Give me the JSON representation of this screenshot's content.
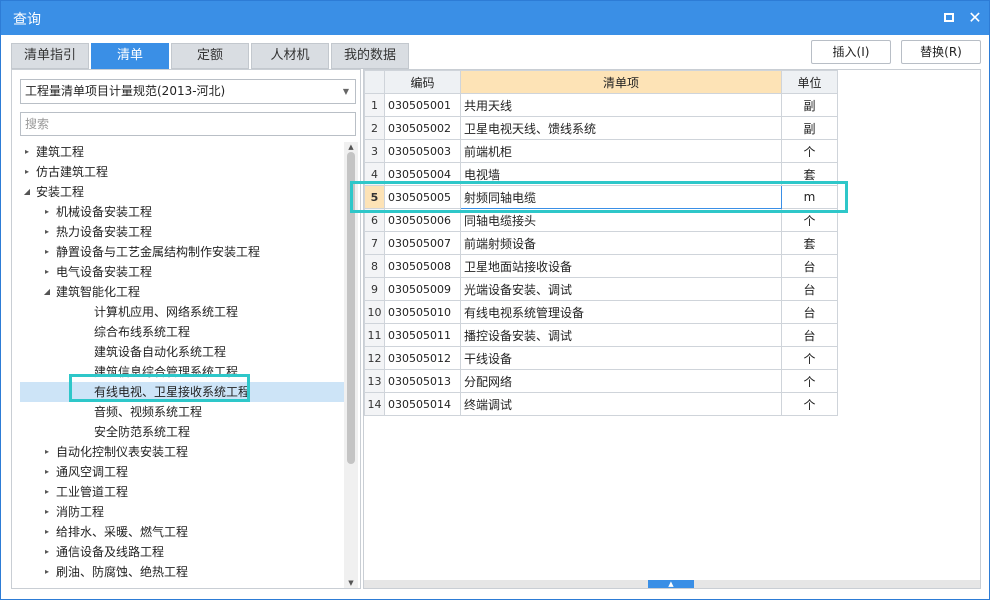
{
  "window": {
    "title": "查询"
  },
  "tabs": [
    {
      "label": "清单指引"
    },
    {
      "label": "清单"
    },
    {
      "label": "定额"
    },
    {
      "label": "人材机"
    },
    {
      "label": "我的数据"
    }
  ],
  "actions": {
    "insert_label": "插入(I)",
    "replace_label": "替换(R)"
  },
  "left": {
    "standard_select": "工程量清单项目计量规范(2013-河北)",
    "search_placeholder": "搜索",
    "tree": [
      {
        "label": "建筑工程",
        "caret": "▸",
        "level": 0
      },
      {
        "label": "仿古建筑工程",
        "caret": "▸",
        "level": 0
      },
      {
        "label": "安装工程",
        "caret": "◢",
        "level": 0
      },
      {
        "label": "机械设备安装工程",
        "caret": "▸",
        "level": 1
      },
      {
        "label": "热力设备安装工程",
        "caret": "▸",
        "level": 1
      },
      {
        "label": "静置设备与工艺金属结构制作安装工程",
        "caret": "▸",
        "level": 1
      },
      {
        "label": "电气设备安装工程",
        "caret": "▸",
        "level": 1
      },
      {
        "label": "建筑智能化工程",
        "caret": "◢",
        "level": 1
      },
      {
        "label": "计算机应用、网络系统工程",
        "caret": "",
        "level": 2
      },
      {
        "label": "综合布线系统工程",
        "caret": "",
        "level": 2
      },
      {
        "label": "建筑设备自动化系统工程",
        "caret": "",
        "level": 2
      },
      {
        "label": "建筑信息综合管理系统工程",
        "caret": "",
        "level": 2
      },
      {
        "label": "有线电视、卫星接收系统工程",
        "caret": "",
        "level": 2
      },
      {
        "label": "音频、视频系统工程",
        "caret": "",
        "level": 2
      },
      {
        "label": "安全防范系统工程",
        "caret": "",
        "level": 2
      },
      {
        "label": "自动化控制仪表安装工程",
        "caret": "▸",
        "level": 1
      },
      {
        "label": "通风空调工程",
        "caret": "▸",
        "level": 1
      },
      {
        "label": "工业管道工程",
        "caret": "▸",
        "level": 1
      },
      {
        "label": "消防工程",
        "caret": "▸",
        "level": 1
      },
      {
        "label": "给排水、采暖、燃气工程",
        "caret": "▸",
        "level": 1
      },
      {
        "label": "通信设备及线路工程",
        "caret": "▸",
        "level": 1
      },
      {
        "label": "刷油、防腐蚀、绝热工程",
        "caret": "▸",
        "level": 1
      }
    ]
  },
  "grid": {
    "headers": {
      "index": "",
      "code": "编码",
      "name": "清单项",
      "unit": "单位"
    },
    "rows": [
      {
        "index": "1",
        "code": "030505001",
        "name": "共用天线",
        "unit": "副"
      },
      {
        "index": "2",
        "code": "030505002",
        "name": "卫星电视天线、馈线系统",
        "unit": "副"
      },
      {
        "index": "3",
        "code": "030505003",
        "name": "前端机柜",
        "unit": "个"
      },
      {
        "index": "4",
        "code": "030505004",
        "name": "电视墙",
        "unit": "套"
      },
      {
        "index": "5",
        "code": "030505005",
        "name": "射频同轴电缆",
        "unit": "m"
      },
      {
        "index": "6",
        "code": "030505006",
        "name": "同轴电缆接头",
        "unit": "个"
      },
      {
        "index": "7",
        "code": "030505007",
        "name": "前端射频设备",
        "unit": "套"
      },
      {
        "index": "8",
        "code": "030505008",
        "name": "卫星地面站接收设备",
        "unit": "台"
      },
      {
        "index": "9",
        "code": "030505009",
        "name": "光端设备安装、调试",
        "unit": "台"
      },
      {
        "index": "10",
        "code": "030505010",
        "name": "有线电视系统管理设备",
        "unit": "台"
      },
      {
        "index": "11",
        "code": "030505011",
        "name": "播控设备安装、调试",
        "unit": "台"
      },
      {
        "index": "12",
        "code": "030505012",
        "name": "干线设备",
        "unit": "个"
      },
      {
        "index": "13",
        "code": "030505013",
        "name": "分配网络",
        "unit": "个"
      },
      {
        "index": "14",
        "code": "030505014",
        "name": "终端调试",
        "unit": "个"
      }
    ]
  },
  "colors": {
    "accent": "#3a8fe6",
    "highlight": "#2ec7c9",
    "header_accent": "#fde3b6",
    "selection": "#cde4f7"
  }
}
